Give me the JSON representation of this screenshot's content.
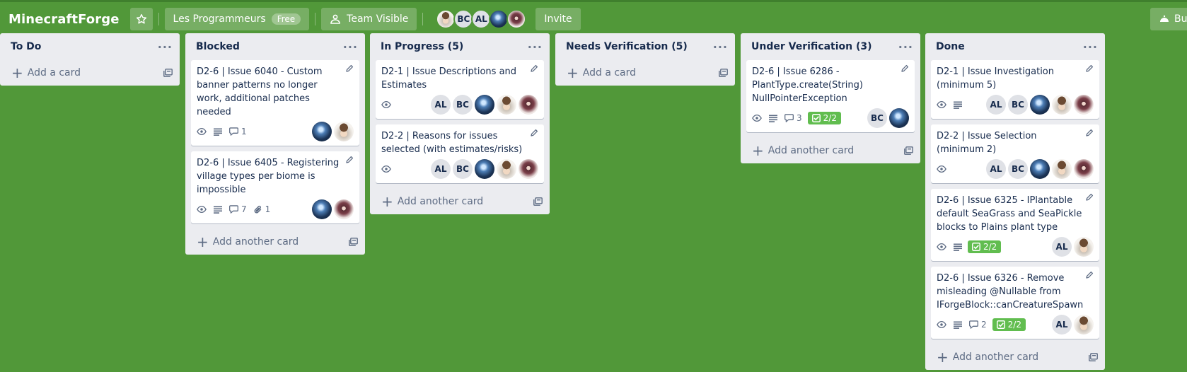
{
  "board": {
    "title": "MinecraftForge",
    "workspace": "Les Programmeurs",
    "workspace_badge": "Free",
    "visibility": "Team Visible",
    "invite_label": "Invite",
    "right_button_label": "But",
    "members": [
      {
        "type": "face"
      },
      {
        "type": "initials",
        "text": "BC"
      },
      {
        "type": "initials",
        "text": "AL"
      },
      {
        "type": "blue"
      },
      {
        "type": "girl"
      }
    ]
  },
  "colors": {
    "board_bg": "#519839",
    "checklist_done": "#61bd4f"
  },
  "lists": [
    {
      "name": "To Do",
      "add_label": "Add a card",
      "cards": []
    },
    {
      "name": "Blocked",
      "add_label": "Add another card",
      "cards": [
        {
          "title": "D2-6 | Issue 6040 - Custom banner patterns no longer work, additional patches needed",
          "badges": {
            "watch": true,
            "description": true,
            "comments": "1"
          },
          "members": [
            "blue",
            "face"
          ]
        },
        {
          "title": "D2-6 | Issue 6405 - Registering village types per biome is impossible",
          "badges": {
            "watch": true,
            "description": true,
            "comments": "7",
            "attachments": "1"
          },
          "members": [
            "blue",
            "girl"
          ]
        }
      ]
    },
    {
      "name": "In Progress (5)",
      "add_label": "Add another card",
      "cards": [
        {
          "title": "D2-1 | Issue Descriptions and Estimates",
          "badges": {
            "watch": true
          },
          "members": [
            "AL",
            "BC",
            "blue",
            "face",
            "girl"
          ]
        },
        {
          "title": "D2-2 | Reasons for issues selected (with estimates/risks)",
          "badges": {
            "watch": true
          },
          "members": [
            "AL",
            "BC",
            "blue",
            "face",
            "girl"
          ]
        }
      ]
    },
    {
      "name": "Needs Verification (5)",
      "add_label": "Add a card",
      "cards": []
    },
    {
      "name": "Under Verification (3)",
      "add_label": "Add another card",
      "cards": [
        {
          "title": "D2-6 | Issue 6286 - PlantType.create(String) NullPointerException",
          "badges": {
            "watch": true,
            "description": true,
            "comments": "3",
            "checklist": "2/2"
          },
          "members": [
            "BC",
            "blue"
          ]
        }
      ]
    },
    {
      "name": "Done",
      "add_label": "Add another card",
      "cards": [
        {
          "title": "D2-1 | Issue Investigation (minimum 5)",
          "badges": {
            "watch": true,
            "description": true
          },
          "members": [
            "AL",
            "BC",
            "blue",
            "face",
            "girl"
          ]
        },
        {
          "title": "D2-2 | Issue Selection (minimum 2)",
          "badges": {
            "watch": true
          },
          "members": [
            "AL",
            "BC",
            "blue",
            "face",
            "girl"
          ]
        },
        {
          "title": "D2-6 | Issue 6325 - IPlantable default SeaGrass and SeaPickle blocks to Plains plant type",
          "badges": {
            "watch": true,
            "description": true,
            "checklist": "2/2"
          },
          "members": [
            "AL",
            "face"
          ]
        },
        {
          "title": "D2-6 | Issue 6326 - Remove misleading @Nullable from IForgeBlock::canCreatureSpawn",
          "badges": {
            "watch": true,
            "description": true,
            "comments": "2",
            "checklist": "2/2"
          },
          "members": [
            "AL",
            "face"
          ]
        }
      ]
    }
  ]
}
